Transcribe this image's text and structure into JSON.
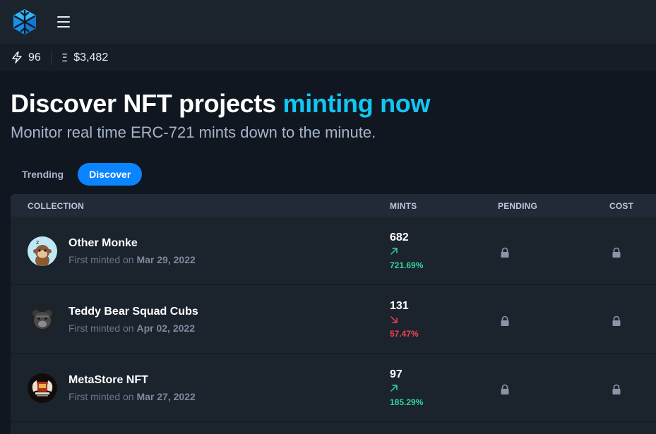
{
  "nav": {
    "logo_icon": "snowflake-cube-logo",
    "menu_icon": "hamburger-menu-icon"
  },
  "stats": {
    "gas_icon": "lightning-icon",
    "gas_value": "96",
    "eth_icon": "ethereum-icon",
    "eth_glyph": "Ξ",
    "eth_price": "$3,482"
  },
  "hero": {
    "title_main": "Discover NFT projects ",
    "title_accent": "minting now",
    "subtitle": "Monitor real time ERC-721 mints down to the minute."
  },
  "tabs": [
    {
      "label": "Trending",
      "active": false
    },
    {
      "label": "Discover",
      "active": true
    }
  ],
  "table": {
    "columns": {
      "collection": "COLLECTION",
      "mints": "MINTS",
      "pending": "PENDING",
      "cost": "COST"
    },
    "rows": [
      {
        "name": "Other Monke",
        "minted_prefix": "First minted on ",
        "minted_date": "Mar 29, 2022",
        "mints": "682",
        "trend": "up",
        "change": "721.69%",
        "pending_icon": "lock-icon",
        "cost_icon": "lock-icon"
      },
      {
        "name": "Teddy Bear Squad Cubs",
        "minted_prefix": "First minted on ",
        "minted_date": "Apr 02, 2022",
        "mints": "131",
        "trend": "down",
        "change": "57.47%",
        "pending_icon": "lock-icon",
        "cost_icon": "lock-icon"
      },
      {
        "name": "MetaStore NFT",
        "minted_prefix": "First minted on ",
        "minted_date": "Mar 27, 2022",
        "mints": "97",
        "trend": "up",
        "change": "185.29%",
        "pending_icon": "lock-icon",
        "cost_icon": "lock-icon"
      }
    ]
  },
  "colors": {
    "accent": "#12c6f3",
    "tab_active": "#0a84ff",
    "up": "#34d399",
    "down": "#f0444f"
  }
}
